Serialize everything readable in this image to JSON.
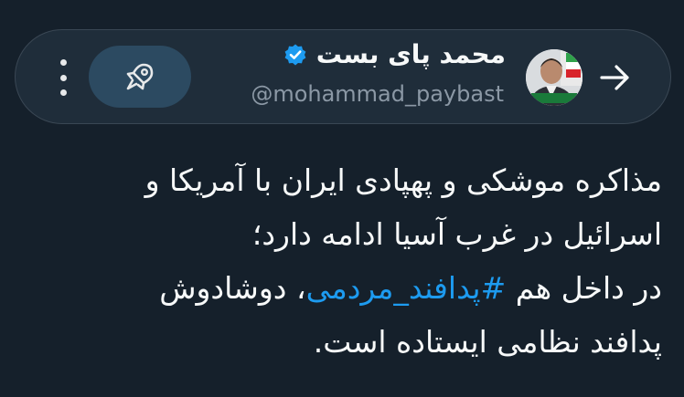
{
  "header": {
    "display_name": "محمد پای بست",
    "handle": "@mohammad_paybast",
    "verified": true,
    "back_icon": "arrow-right-icon",
    "verified_icon": "verified-badge-icon",
    "boost_icon": "rocket-icon",
    "more_icon": "more-vertical-icon",
    "avatar_caption": "محمد پای بست"
  },
  "tweet": {
    "line1": "مذاکره موشکی و پهپادی ایران با آمریکا و",
    "line2": "اسرائیل در غرب آسیا ادامه دارد؛",
    "line3_prefix": "در داخل هم ",
    "hashtag": "#پدافند_مردمی",
    "line3_suffix": "، دوشادوش",
    "line4": "پدافند نظامی ایستاده است."
  },
  "colors": {
    "background": "#15202b",
    "header_bg": "#1f2d3a",
    "accent": "#1d9bf0",
    "muted": "#8b98a5",
    "rocket_button_bg": "#2c4a61"
  }
}
